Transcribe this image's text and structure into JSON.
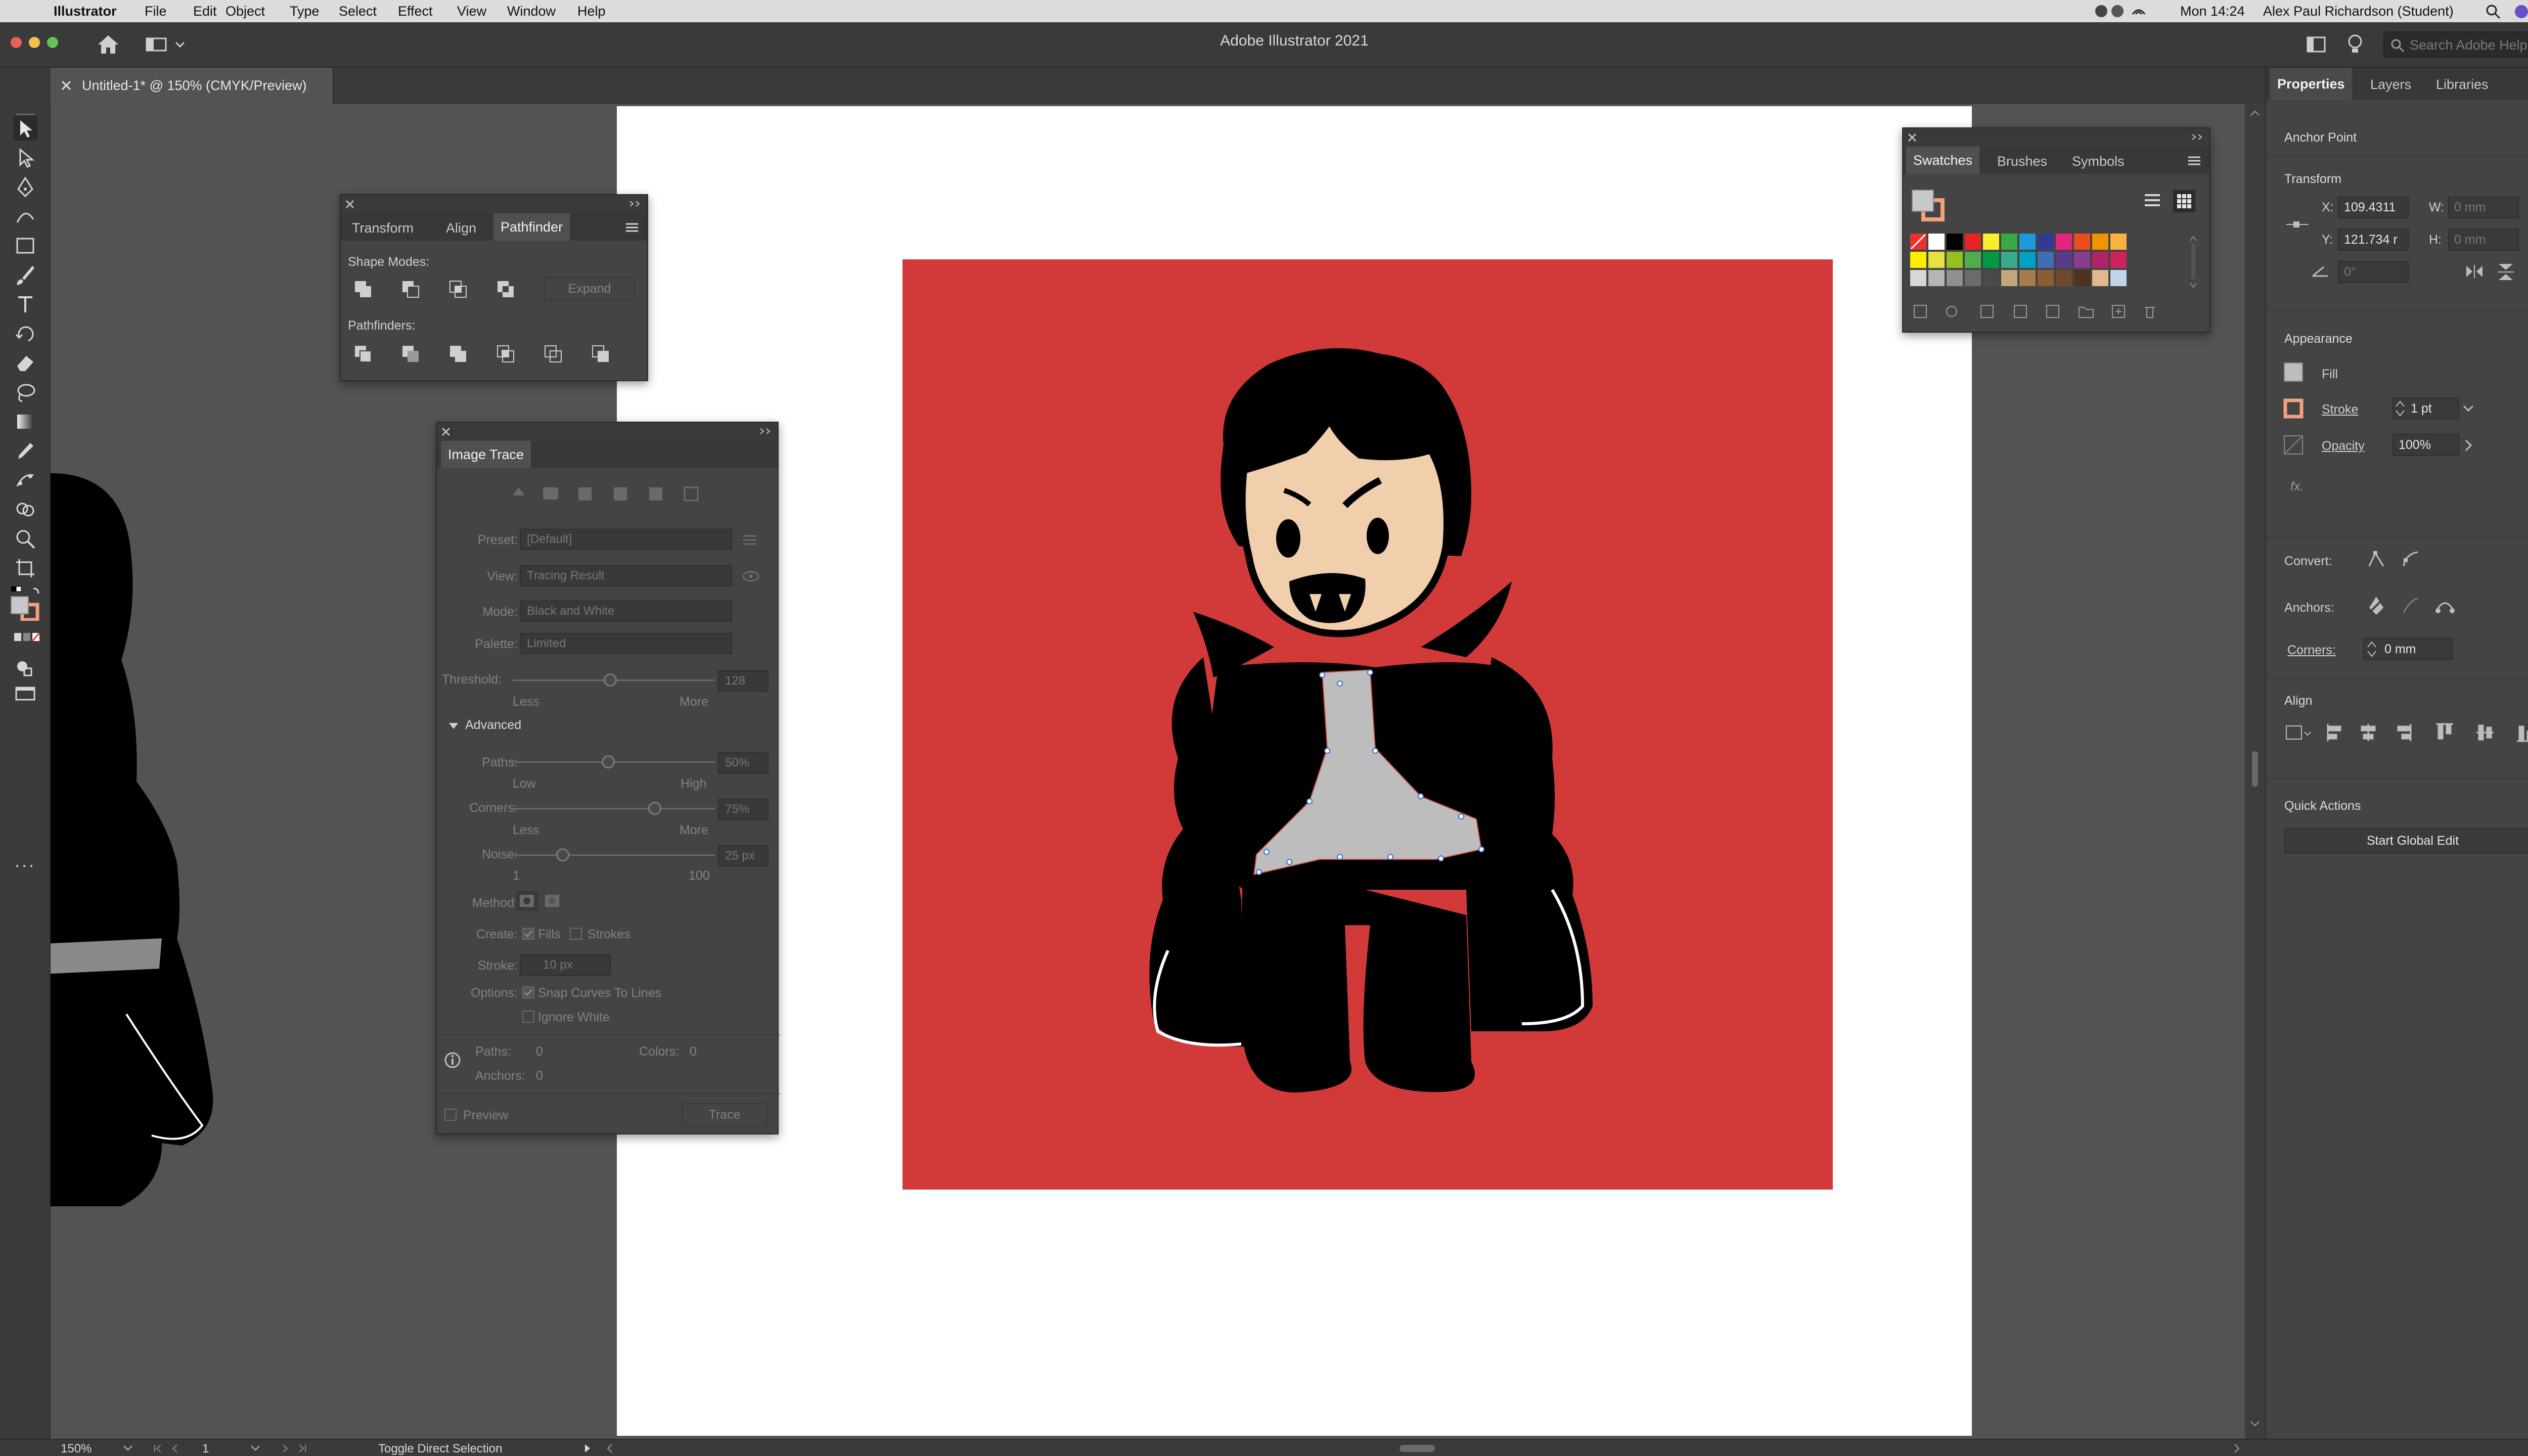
{
  "menubar": {
    "app_name": "Illustrator",
    "menus": [
      "File",
      "Edit",
      "Object",
      "Type",
      "Select",
      "Effect",
      "View",
      "Window",
      "Help"
    ],
    "clock": "Mon 14:24",
    "user": "Alex Paul Richardson (Student)"
  },
  "appbar": {
    "title": "Adobe Illustrator 2021",
    "search_placeholder": "Search Adobe Help"
  },
  "document_tab": {
    "label": "Untitled-1* @ 150% (CMYK/Preview)"
  },
  "pathfinder_panel": {
    "tabs": [
      "Transform",
      "Align",
      "Pathfinder"
    ],
    "active_tab": "Pathfinder",
    "shape_modes_label": "Shape Modes:",
    "expand_label": "Expand",
    "pathfinders_label": "Pathfinders:"
  },
  "image_trace": {
    "title": "Image Trace",
    "preset_label": "Preset:",
    "preset_value": "[Default]",
    "view_label": "View:",
    "view_value": "Tracing Result",
    "mode_label": "Mode:",
    "mode_value": "Black and White",
    "palette_label": "Palette:",
    "palette_value": "Limited",
    "threshold_label": "Threshold:",
    "threshold_value": "128",
    "less": "Less",
    "more": "More",
    "advanced_label": "Advanced",
    "paths_label": "Paths:",
    "paths_value": "50%",
    "low": "Low",
    "high": "High",
    "corners_label": "Corners:",
    "corners_value": "75%",
    "noise_label": "Noise:",
    "noise_value": "25 px",
    "noise_min": "1",
    "noise_max": "100",
    "method_label": "Method:",
    "create_label": "Create:",
    "fills_label": "Fills",
    "strokes_label": "Strokes",
    "stroke_label": "Stroke:",
    "stroke_value": "10 px",
    "options_label": "Options:",
    "snap_label": "Snap Curves To Lines",
    "ignore_white_label": "Ignore White",
    "info_paths_label": "Paths:",
    "info_paths_value": "0",
    "info_colors_label": "Colors:",
    "info_colors_value": "0",
    "info_anchors_label": "Anchors:",
    "info_anchors_value": "0",
    "preview_label": "Preview",
    "trace_label": "Trace"
  },
  "swatches_panel": {
    "tabs": [
      "Swatches",
      "Brushes",
      "Symbols"
    ],
    "active_tab": "Swatches",
    "colors": [
      "#e9322d",
      "#ffffff",
      "#000000",
      "#e52521",
      "#fcec2f",
      "#3aa845",
      "#1a9ad6",
      "#2f3c8f",
      "#e5247b",
      "#e94e1b",
      "#f39200",
      "#fab23f",
      "#ffed00",
      "#e4e141",
      "#95c11f",
      "#4cae50",
      "#009a44",
      "#3aaa8b",
      "#00a0c6",
      "#3f6eb5",
      "#5b3a8b",
      "#8a3c8e",
      "#b0236b",
      "#d0215f",
      "#d7d7d7",
      "#b5b5b5",
      "#8f8f8f",
      "#6b6b6b",
      "#4a4a4a",
      "#c3a67a",
      "#a67b4e",
      "#8b5d33",
      "#6e4a2a",
      "#4d3320",
      "#e1b98c",
      "#bfd6e8"
    ]
  },
  "properties_panel": {
    "tabs": [
      "Properties",
      "Layers",
      "Libraries"
    ],
    "active_tab": "Properties",
    "selection_type": "Anchor Point",
    "transform_label": "Transform",
    "x_label": "X:",
    "x_value": "109.4311",
    "y_label": "Y:",
    "y_value": "121.734 r",
    "w_label": "W:",
    "w_value": "0 mm",
    "h_label": "H:",
    "h_value": "0 mm",
    "angle_value": "0°",
    "appearance_label": "Appearance",
    "fill_label": "Fill",
    "stroke_label": "Stroke",
    "stroke_value": "1 pt",
    "opacity_label": "Opacity",
    "opacity_value": "100%",
    "fx_label": "fx.",
    "convert_label": "Convert:",
    "anchors_label": "Anchors:",
    "corners_label": "Corners:",
    "corners_value": "0 mm",
    "align_label": "Align",
    "quick_actions_label": "Quick Actions",
    "global_edit_label": "Start Global Edit"
  },
  "statusbar": {
    "zoom": "150%",
    "artboard": "1",
    "tool_hint": "Toggle Direct Selection"
  },
  "colors": {
    "artboard_fill": "#d23a3a",
    "skin": "#f2cfac",
    "shirt": "#bdbdbd",
    "ui_dark": "#3a3a3a",
    "ui_panel": "#444444"
  }
}
